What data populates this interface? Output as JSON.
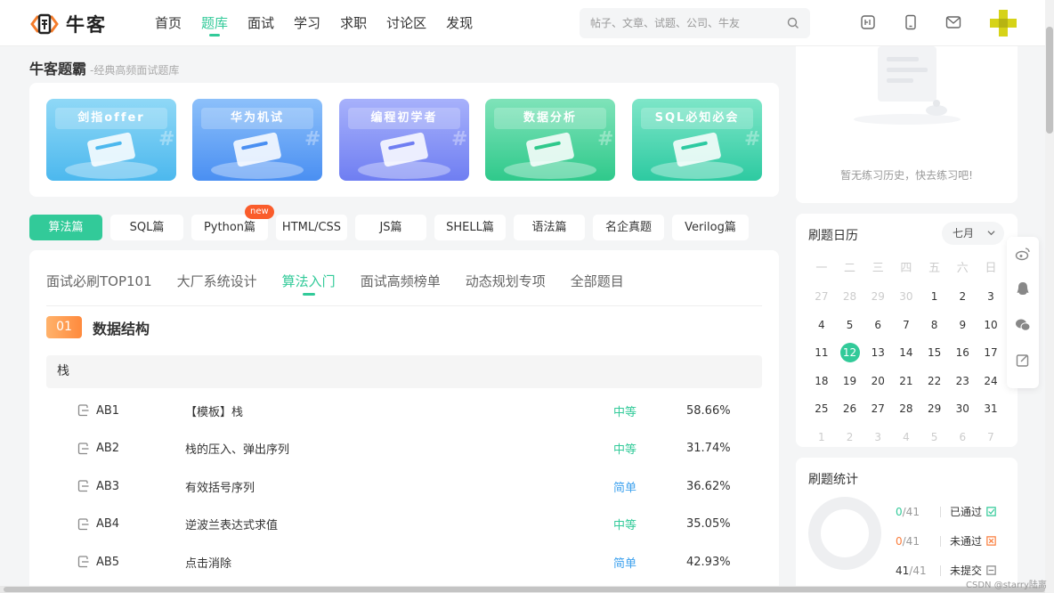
{
  "header": {
    "logo_text": "牛客",
    "nav": [
      {
        "label": "首页",
        "active": false
      },
      {
        "label": "题库",
        "active": true
      },
      {
        "label": "面试",
        "active": false
      },
      {
        "label": "学习",
        "active": false
      },
      {
        "label": "求职",
        "active": false
      },
      {
        "label": "讨论区",
        "active": false
      },
      {
        "label": "发现",
        "active": false
      }
    ],
    "search_placeholder": "帖子、文章、试题、公司、牛友"
  },
  "page": {
    "title": "牛客题霸",
    "subtitle": "-经典高频面试题库"
  },
  "banners": [
    {
      "label": "剑指offer",
      "color_from": "#8fd8f6",
      "color_to": "#4cb8ee"
    },
    {
      "label": "华为机试",
      "color_from": "#8cc0fa",
      "color_to": "#4a8ff2"
    },
    {
      "label": "编程初学者",
      "color_from": "#a7b1fb",
      "color_to": "#6f7ef2"
    },
    {
      "label": "数据分析",
      "color_from": "#7fe3b9",
      "color_to": "#2fc98b"
    },
    {
      "label": "SQL必知必会",
      "color_from": "#7ee6c8",
      "color_to": "#2dcaa1"
    }
  ],
  "categories": [
    {
      "label": "算法篇",
      "active": true,
      "badge": ""
    },
    {
      "label": "SQL篇",
      "active": false,
      "badge": ""
    },
    {
      "label": "Python篇",
      "active": false,
      "badge": "new"
    },
    {
      "label": "HTML/CSS",
      "active": false,
      "badge": ""
    },
    {
      "label": "JS篇",
      "active": false,
      "badge": ""
    },
    {
      "label": "SHELL篇",
      "active": false,
      "badge": ""
    },
    {
      "label": "语法篇",
      "active": false,
      "badge": ""
    },
    {
      "label": "名企真题",
      "active": false,
      "badge": ""
    },
    {
      "label": "Verilog篇",
      "active": false,
      "badge": ""
    }
  ],
  "tabs": [
    {
      "label": "面试必刷TOP101",
      "active": false
    },
    {
      "label": "大厂系统设计",
      "active": false
    },
    {
      "label": "算法入门",
      "active": true
    },
    {
      "label": "面试高频榜单",
      "active": false
    },
    {
      "label": "动态规划专项",
      "active": false
    },
    {
      "label": "全部题目",
      "active": false
    }
  ],
  "section": {
    "number": "01",
    "title": "数据结构"
  },
  "group": {
    "title": "栈"
  },
  "problems": [
    {
      "code": "AB1",
      "name": "【模板】栈",
      "difficulty": "中等",
      "level": "mid",
      "pass_rate": "58.66%"
    },
    {
      "code": "AB2",
      "name": "栈的压入、弹出序列",
      "difficulty": "中等",
      "level": "mid",
      "pass_rate": "31.74%"
    },
    {
      "code": "AB3",
      "name": "有效括号序列",
      "difficulty": "简单",
      "level": "easy",
      "pass_rate": "36.62%"
    },
    {
      "code": "AB4",
      "name": "逆波兰表达式求值",
      "difficulty": "中等",
      "level": "mid",
      "pass_rate": "35.05%"
    },
    {
      "code": "AB5",
      "name": "点击消除",
      "difficulty": "简单",
      "level": "easy",
      "pass_rate": "42.93%"
    }
  ],
  "history": {
    "empty_text": "暂无练习历史，快去练习吧!"
  },
  "calendar": {
    "title": "刷题日历",
    "month": "七月",
    "weekdays": [
      "一",
      "二",
      "三",
      "四",
      "五",
      "六",
      "日"
    ],
    "weeks": [
      [
        {
          "d": "27",
          "dim": true
        },
        {
          "d": "28",
          "dim": true
        },
        {
          "d": "29",
          "dim": true
        },
        {
          "d": "30",
          "dim": true
        },
        {
          "d": "1"
        },
        {
          "d": "2"
        },
        {
          "d": "3"
        }
      ],
      [
        {
          "d": "4"
        },
        {
          "d": "5"
        },
        {
          "d": "6"
        },
        {
          "d": "7"
        },
        {
          "d": "8"
        },
        {
          "d": "9"
        },
        {
          "d": "10"
        }
      ],
      [
        {
          "d": "11"
        },
        {
          "d": "12",
          "today": true
        },
        {
          "d": "13"
        },
        {
          "d": "14"
        },
        {
          "d": "15"
        },
        {
          "d": "16"
        },
        {
          "d": "17"
        }
      ],
      [
        {
          "d": "18"
        },
        {
          "d": "19"
        },
        {
          "d": "20"
        },
        {
          "d": "21"
        },
        {
          "d": "22"
        },
        {
          "d": "23"
        },
        {
          "d": "24"
        }
      ],
      [
        {
          "d": "25"
        },
        {
          "d": "26"
        },
        {
          "d": "27"
        },
        {
          "d": "28"
        },
        {
          "d": "29"
        },
        {
          "d": "30"
        },
        {
          "d": "31"
        }
      ],
      [
        {
          "d": "1",
          "dim": true
        },
        {
          "d": "2",
          "dim": true
        },
        {
          "d": "3",
          "dim": true
        },
        {
          "d": "4",
          "dim": true
        },
        {
          "d": "5",
          "dim": true
        },
        {
          "d": "6",
          "dim": true
        },
        {
          "d": "7",
          "dim": true
        }
      ]
    ]
  },
  "stats": {
    "title": "刷题统计",
    "rows": [
      {
        "count": "0",
        "total": "/41",
        "label": "已通过",
        "tone": "a"
      },
      {
        "count": "0",
        "total": "/41",
        "label": "未通过",
        "tone": "b"
      },
      {
        "count": "41",
        "total": "/41",
        "label": "未提交",
        "tone": "c"
      }
    ]
  },
  "watermark": "CSDN @starry陆离",
  "colors": {
    "accent": "#32ca99",
    "easy": "#3fa2ee",
    "orange": "#fa7d3c"
  }
}
